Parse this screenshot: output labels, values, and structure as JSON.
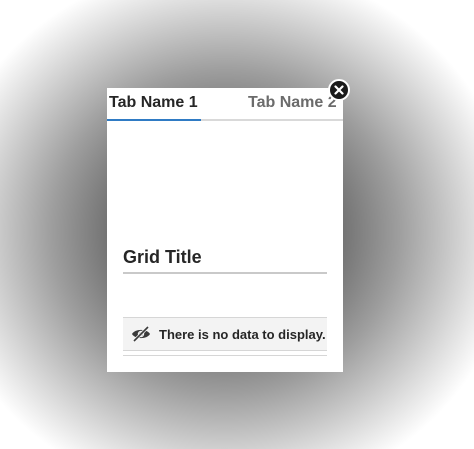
{
  "tabs": [
    {
      "label": "Tab Name 1",
      "active": true
    },
    {
      "label": "Tab Name 2",
      "active": false
    }
  ],
  "grid": {
    "title": "Grid Title",
    "empty_message": "There is no data to display.",
    "empty_icon": "eye-hidden-icon"
  },
  "close_icon": "close-icon",
  "colors": {
    "active_tab_underline": "#2f7bc4",
    "close_button": "#1a1a1a"
  }
}
